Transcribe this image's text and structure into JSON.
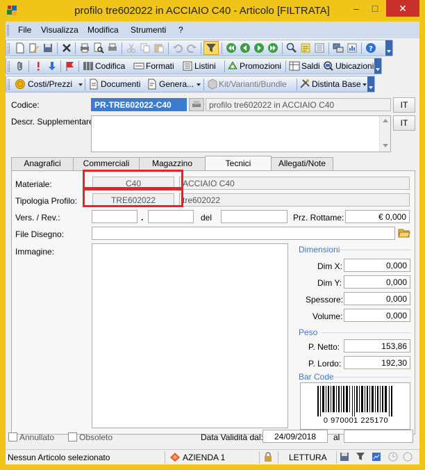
{
  "window": {
    "title": "profilo tre602022 in ACCIAIO C40 - Articolo [FILTRATA]",
    "minimize": "–",
    "maximize": "□",
    "close": "✕"
  },
  "menu": {
    "items": [
      "File",
      "Visualizza",
      "Modifica",
      "Strumenti",
      "?"
    ]
  },
  "toolbar2": {
    "codifica": "Codifica",
    "formati": "Formati",
    "listini": "Listini",
    "promozioni": "Promozioni",
    "saldi": "Saldi",
    "ubicazioni": "Ubicazioni"
  },
  "toolbar3": {
    "costi_prezzi": "Costi/Prezzi",
    "documenti": "Documenti",
    "genera": "Genera...",
    "kit_varianti": "Kit/Varianti/Bundle",
    "distinta_base": "Distinta Base"
  },
  "header": {
    "codice_label": "Codice:",
    "codice_value": "PR-TRE602022-C40",
    "descrizione_value": "profilo tre602022 in ACCIAIO C40",
    "lang_button": "IT",
    "descr_suppl_label": "Descr. Supplementare:",
    "descr_suppl_value": "",
    "lang_button2": "IT"
  },
  "tabs": [
    "Anagrafici",
    "Commerciali",
    "Magazzino",
    "Tecnici",
    "Allegati/Note"
  ],
  "tecnici": {
    "materiale_label": "Materiale:",
    "materiale_code": "C40",
    "materiale_desc": "ACCIAIO C40",
    "tipologia_label": "Tipologia Profilo:",
    "tipologia_code": "TRE602022",
    "tipologia_desc": "tre602022",
    "vers_label": "Vers. / Rev.:",
    "vers_value": "",
    "rev_sep": ".",
    "rev_value": "",
    "del_label": "del",
    "del_value": "",
    "prz_rottame_label": "Prz. Rottame:",
    "prz_rottame_value": "€ 0,000",
    "file_disegno_label": "File Disegno:",
    "file_disegno_value": "",
    "immagine_label": "Immagine:"
  },
  "dimensioni": {
    "title": "Dimensioni",
    "dim_x_label": "Dim X:",
    "dim_x_value": "0,000",
    "dim_y_label": "Dim Y:",
    "dim_y_value": "0,000",
    "spessore_label": "Spessore:",
    "spessore_value": "0,000",
    "volume_label": "Volume:",
    "volume_value": "0,000"
  },
  "peso": {
    "title": "Peso",
    "netto_label": "P. Netto:",
    "netto_value": "153,86",
    "lordo_label": "P. Lordo:",
    "lordo_value": "192,30"
  },
  "barcode": {
    "title": "Bar Code",
    "digits": "0 970001 225170"
  },
  "footer": {
    "annullato_label": "Annullato",
    "obsoleto_label": "Obsoleto",
    "data_validita_label": "Data Validità dal:",
    "data_validita_value": "24/09/2018",
    "al_label": "al",
    "al_value": ""
  },
  "statusbar": {
    "message": "Nessun Articolo selezionato",
    "azienda": "AZIENDA 1",
    "mode": "LETTURA"
  },
  "colors": {
    "title_bar": "#f0c419",
    "close_button": "#c7312a",
    "highlight": "#e0262c",
    "selection": "#3b7bd0",
    "group_title": "#3c78c8"
  }
}
